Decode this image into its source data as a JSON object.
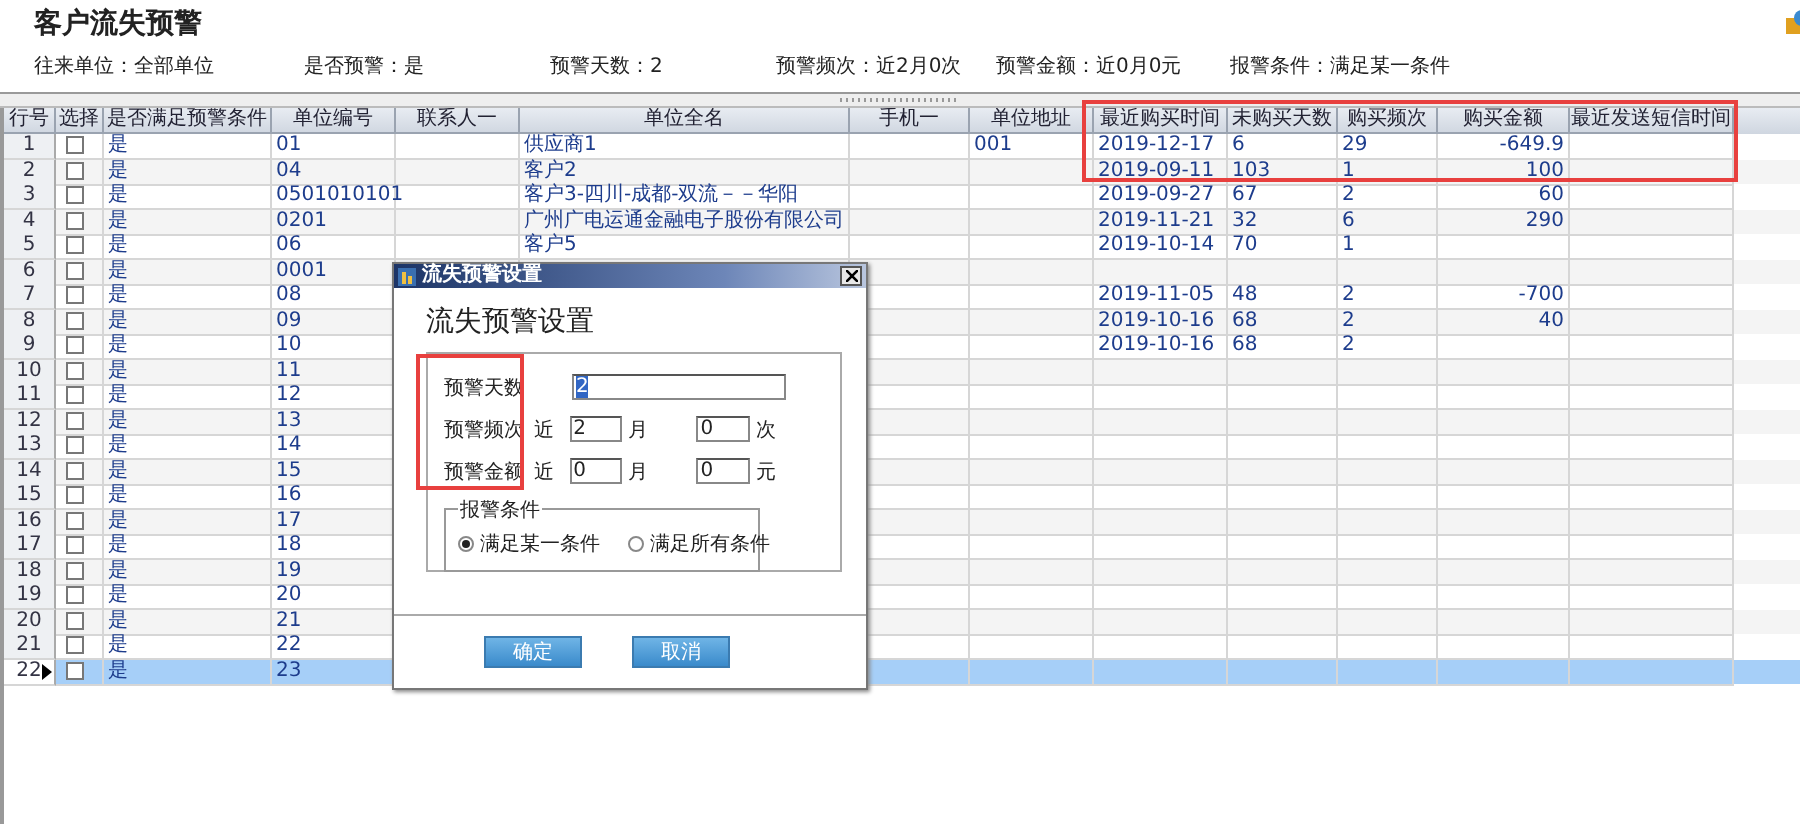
{
  "page": {
    "title": "客户流失预警",
    "filters": [
      "往来单位：全部单位",
      "是否预警：是",
      "预警天数：2",
      "预警频次：近2月0次",
      "预警金额：近0月0元",
      "报警条件：满足某一条件"
    ]
  },
  "table": {
    "columns": [
      "行号",
      "选择",
      "是否满足预警条件",
      "单位编号",
      "联系人一",
      "单位全名",
      "手机一",
      "单位地址",
      "最近购买时间",
      "未购买天数",
      "购买频次",
      "购买金额",
      "最近发送短信时间"
    ],
    "rows": [
      {
        "no": "1",
        "checked": false,
        "selected": false,
        "meets": "是",
        "code": "01",
        "name": "供应商1",
        "address": "001",
        "last": "2019-12-17",
        "days": "6",
        "freq": "29",
        "amount": "-649.9"
      },
      {
        "no": "2",
        "checked": false,
        "selected": false,
        "meets": "是",
        "code": "04",
        "name": "客户2",
        "last": "2019-09-11",
        "days": "103",
        "freq": "1",
        "amount": "100"
      },
      {
        "no": "3",
        "checked": false,
        "selected": false,
        "meets": "是",
        "code": "0501010101",
        "name": "客户3-四川-成都-双流－－华阳",
        "last": "2019-09-27",
        "days": "67",
        "freq": "2",
        "amount": "60"
      },
      {
        "no": "4",
        "checked": false,
        "selected": false,
        "meets": "是",
        "code": "0201",
        "name": "广州广电运通金融电子股份有限公司",
        "last": "2019-11-21",
        "days": "32",
        "freq": "6",
        "amount": "290"
      },
      {
        "no": "5",
        "checked": false,
        "selected": false,
        "meets": "是",
        "code": "06",
        "name": "客户5",
        "last": "2019-10-14",
        "days": "70",
        "freq": "1"
      },
      {
        "no": "6",
        "checked": false,
        "selected": false,
        "meets": "是",
        "code": "0001"
      },
      {
        "no": "7",
        "checked": false,
        "selected": false,
        "meets": "是",
        "code": "08",
        "last": "2019-11-05",
        "days": "48",
        "freq": "2",
        "amount": "-700"
      },
      {
        "no": "8",
        "checked": false,
        "selected": false,
        "meets": "是",
        "code": "09",
        "last": "2019-10-16",
        "days": "68",
        "freq": "2",
        "amount": "40"
      },
      {
        "no": "9",
        "checked": false,
        "selected": false,
        "meets": "是",
        "code": "10",
        "last": "2019-10-16",
        "days": "68",
        "freq": "2"
      },
      {
        "no": "10",
        "checked": false,
        "selected": false,
        "meets": "是",
        "code": "11"
      },
      {
        "no": "11",
        "checked": false,
        "selected": false,
        "meets": "是",
        "code": "12"
      },
      {
        "no": "12",
        "checked": false,
        "selected": false,
        "meets": "是",
        "code": "13"
      },
      {
        "no": "13",
        "checked": false,
        "selected": false,
        "meets": "是",
        "code": "14"
      },
      {
        "no": "14",
        "checked": false,
        "selected": false,
        "meets": "是",
        "code": "15"
      },
      {
        "no": "15",
        "checked": false,
        "selected": false,
        "meets": "是",
        "code": "16"
      },
      {
        "no": "16",
        "checked": false,
        "selected": false,
        "meets": "是",
        "code": "17"
      },
      {
        "no": "17",
        "checked": false,
        "selected": false,
        "meets": "是",
        "code": "18"
      },
      {
        "no": "18",
        "checked": false,
        "selected": false,
        "meets": "是",
        "code": "19"
      },
      {
        "no": "19",
        "checked": false,
        "selected": false,
        "meets": "是",
        "code": "20"
      },
      {
        "no": "20",
        "checked": false,
        "selected": false,
        "meets": "是",
        "code": "21"
      },
      {
        "no": "21",
        "checked": false,
        "selected": false,
        "meets": "是",
        "code": "22"
      },
      {
        "no": "22",
        "checked": false,
        "selected": true,
        "meets": "是",
        "code": "23"
      }
    ]
  },
  "dialog": {
    "title": "流失预警设置",
    "heading": "流失预警设置",
    "fields": [
      {
        "kind": "single",
        "label": "预警天数",
        "value": "2",
        "focused": true
      },
      {
        "kind": "range",
        "label": "预警频次",
        "prefix": "近",
        "months": "2",
        "month_unit": "月",
        "count": "0",
        "unit": "次"
      },
      {
        "kind": "range",
        "label": "预警金额",
        "prefix": "近",
        "months": "0",
        "month_unit": "月",
        "count": "0",
        "unit": "元"
      }
    ],
    "group": {
      "title": "报警条件",
      "options": [
        {
          "label": "满足某一条件",
          "selected": true
        },
        {
          "label": "满足所有条件",
          "selected": false
        }
      ]
    },
    "buttons": [
      "确定",
      "取消"
    ]
  }
}
